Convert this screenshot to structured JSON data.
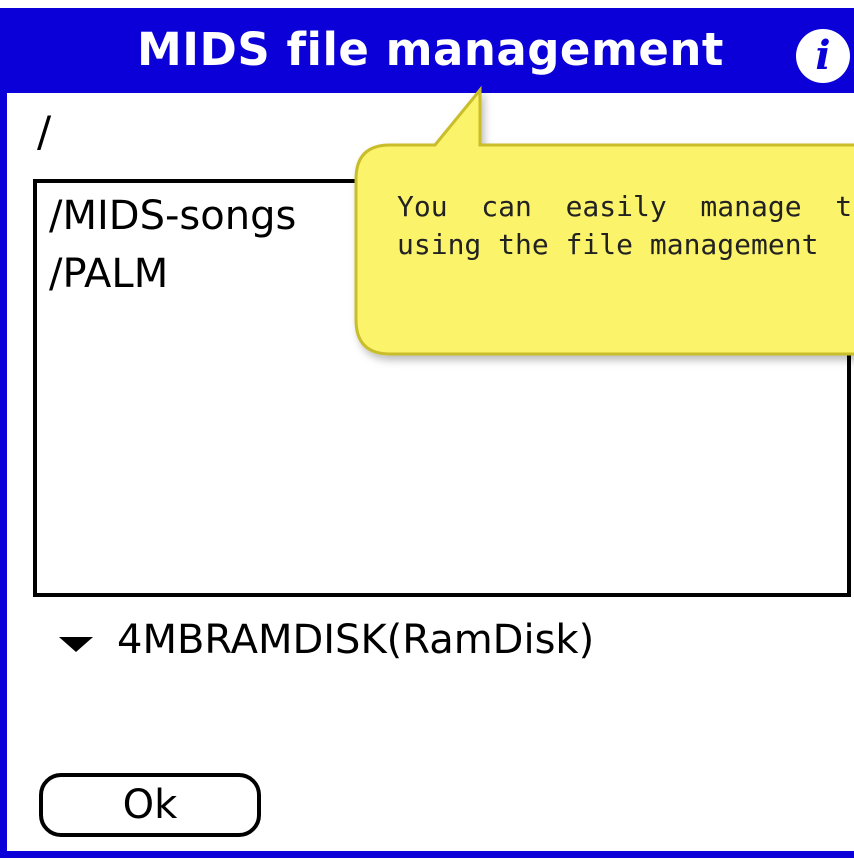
{
  "dialog": {
    "title": "MIDS file management",
    "info_icon": "info-icon"
  },
  "path": "/",
  "files": [
    "/MIDS-songs",
    "/PALM"
  ],
  "volume": {
    "label": "4MBRAMDISK(RamDisk)",
    "dropdown_icon": "triangle-down-icon"
  },
  "ok_label": "Ok",
  "tooltip": {
    "line1": "You  can  easily  manage  t",
    "line2": "using the file management"
  },
  "colors": {
    "titlebar": "#0b00d8",
    "tooltip_fill": "#fbf36b",
    "tooltip_border": "#c9bd2a"
  }
}
